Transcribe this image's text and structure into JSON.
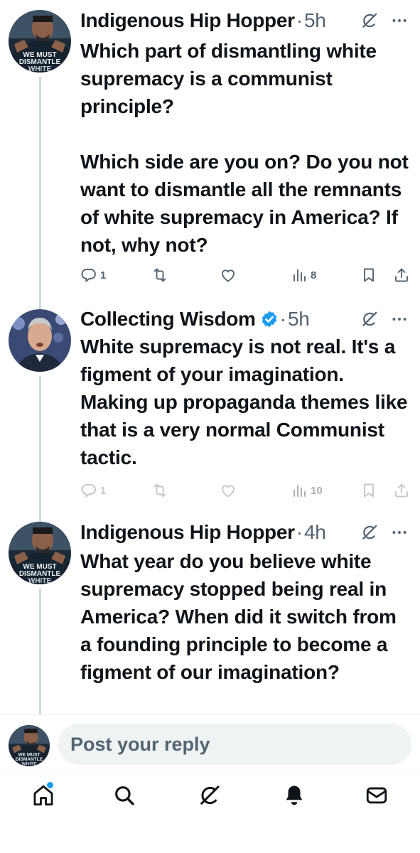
{
  "colors": {
    "text_primary": "#0f1419",
    "text_secondary": "#536471",
    "accent_blue": "#1d9bf0",
    "thread_line": "#cfd9de",
    "input_bg": "#eff3f4"
  },
  "tweets": [
    {
      "author": "Indigenous Hip Hopper",
      "separator": "·",
      "time": "5h",
      "verified": false,
      "avatar_icon": "avatar-shirt-we-must-dismantle",
      "avatar_caption": "WE MUST DISMANTLE WHITE SUPREMACY",
      "text": "Which part of dismantling white supremacy is a communist principle?\n\nWhich side are you on? Do you not want to dismantle all the remnants of white supremacy in America? If not, why not?",
      "replies": "1",
      "reposts": "",
      "likes": "",
      "views": "8"
    },
    {
      "author": "Collecting Wisdom",
      "separator": "·",
      "time": "5h",
      "verified": true,
      "avatar_icon": "avatar-man-in-suit",
      "text": "White supremacy is not real. It's a figment of your imagination. Making up propaganda themes like that is a very normal Communist tactic.",
      "replies": "1",
      "reposts": "",
      "likes": "",
      "views": "10"
    },
    {
      "author": "Indigenous Hip Hopper",
      "separator": "·",
      "time": "4h",
      "verified": false,
      "avatar_icon": "avatar-shirt-we-must-dismantle",
      "avatar_caption": "WE MUST DISMANTLE WHITE SUPREMACY",
      "text": "What year do you believe white supremacy stopped being real in America? When did it switch from a founding principle to become a figment of our imagination?"
    }
  ],
  "reply_bar": {
    "placeholder": "Post your reply"
  },
  "tabbar": {
    "items": [
      "home-icon",
      "search-icon",
      "grok-icon",
      "notifications-icon",
      "messages-icon"
    ],
    "active": "home-icon",
    "home_has_unread": true
  }
}
